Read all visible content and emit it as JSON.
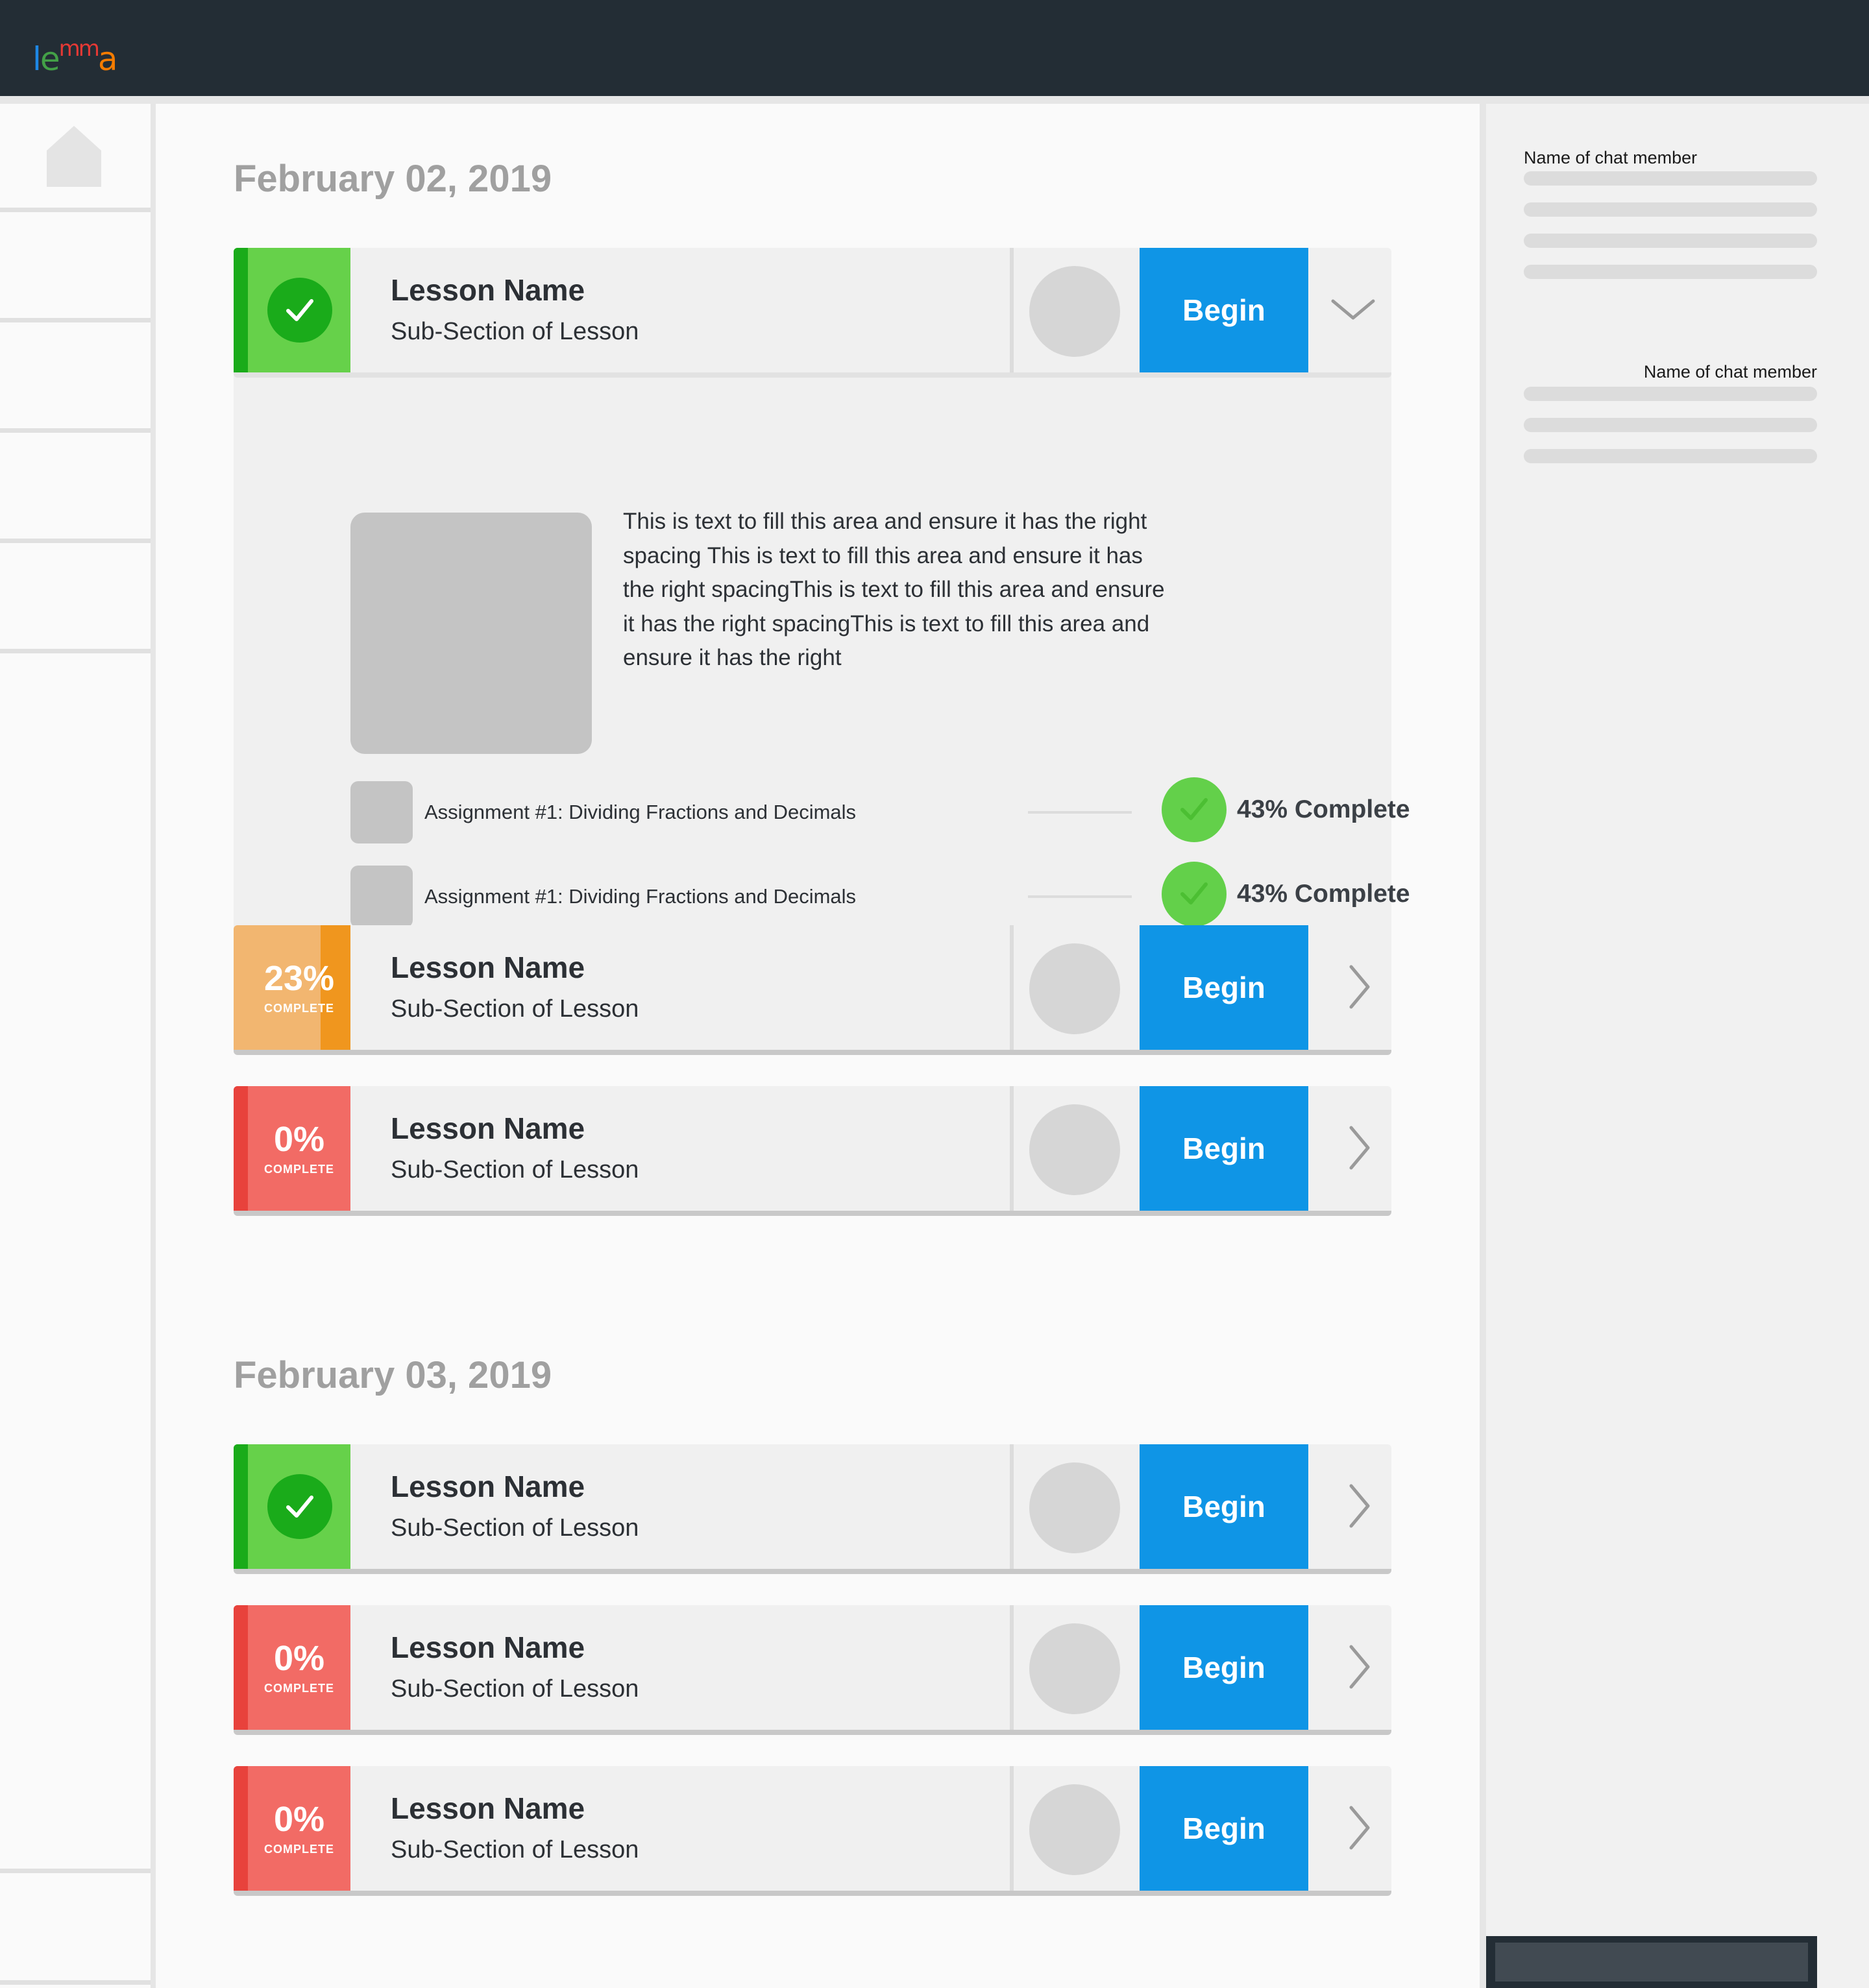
{
  "app": {
    "logo_parts": [
      "l",
      "e",
      "m",
      "m",
      "a"
    ],
    "logo_colors": [
      "#1e88e5",
      "#43a047",
      "#e53935",
      "#f57c00",
      "#f57c00"
    ],
    "colors": {
      "topbar": "#232d35",
      "begin": "#0f95e6",
      "complete": "#66d14a",
      "in_progress": "#f2b670",
      "not_started": "#f26b65"
    }
  },
  "sidebar": {
    "home_icon": "house-icon"
  },
  "sections": [
    {
      "date": "February 02, 2019",
      "lessons": [
        {
          "status": "complete",
          "status_icon": "check-icon",
          "name": "Lesson Name",
          "subsection": "Sub-Section of Lesson",
          "button": "Begin",
          "expanded": true,
          "chevron": "chevron-down-icon",
          "details": {
            "description": "This is text to fill this area and ensure it has the right spacing This is text to fill this area and ensure it has the right spacingThis is text to fill this area and ensure it has the right spacingThis is text to fill this area and ensure it has the right",
            "assignments": [
              {
                "label": "Assignment #1: Dividing Fractions and Decimals",
                "progress": "43% Complete"
              },
              {
                "label": "Assignment #1: Dividing Fractions and Decimals",
                "progress": "43% Complete"
              }
            ]
          }
        },
        {
          "status": "in-progress",
          "percent": "23%",
          "percent_label": "COMPLETE",
          "name": "Lesson Name",
          "subsection": "Sub-Section of Lesson",
          "button": "Begin",
          "chevron": "chevron-right-icon"
        },
        {
          "status": "not-started",
          "percent": "0%",
          "percent_label": "COMPLETE",
          "name": "Lesson Name",
          "subsection": "Sub-Section of Lesson",
          "button": "Begin",
          "chevron": "chevron-right-icon"
        }
      ]
    },
    {
      "date": "February 03, 2019",
      "lessons": [
        {
          "status": "complete",
          "status_icon": "check-icon",
          "name": "Lesson Name",
          "subsection": "Sub-Section of Lesson",
          "button": "Begin",
          "chevron": "chevron-right-icon"
        },
        {
          "status": "not-started",
          "percent": "0%",
          "percent_label": "COMPLETE",
          "name": "Lesson Name",
          "subsection": "Sub-Section of Lesson",
          "button": "Begin",
          "chevron": "chevron-right-icon"
        },
        {
          "status": "not-started",
          "percent": "0%",
          "percent_label": "COMPLETE",
          "name": "Lesson Name",
          "subsection": "Sub-Section of Lesson",
          "button": "Begin",
          "chevron": "chevron-right-icon"
        }
      ]
    }
  ],
  "chat": {
    "members": [
      {
        "name": "Name of chat member",
        "align": "left"
      },
      {
        "name": "Name of chat member",
        "align": "right"
      }
    ]
  }
}
